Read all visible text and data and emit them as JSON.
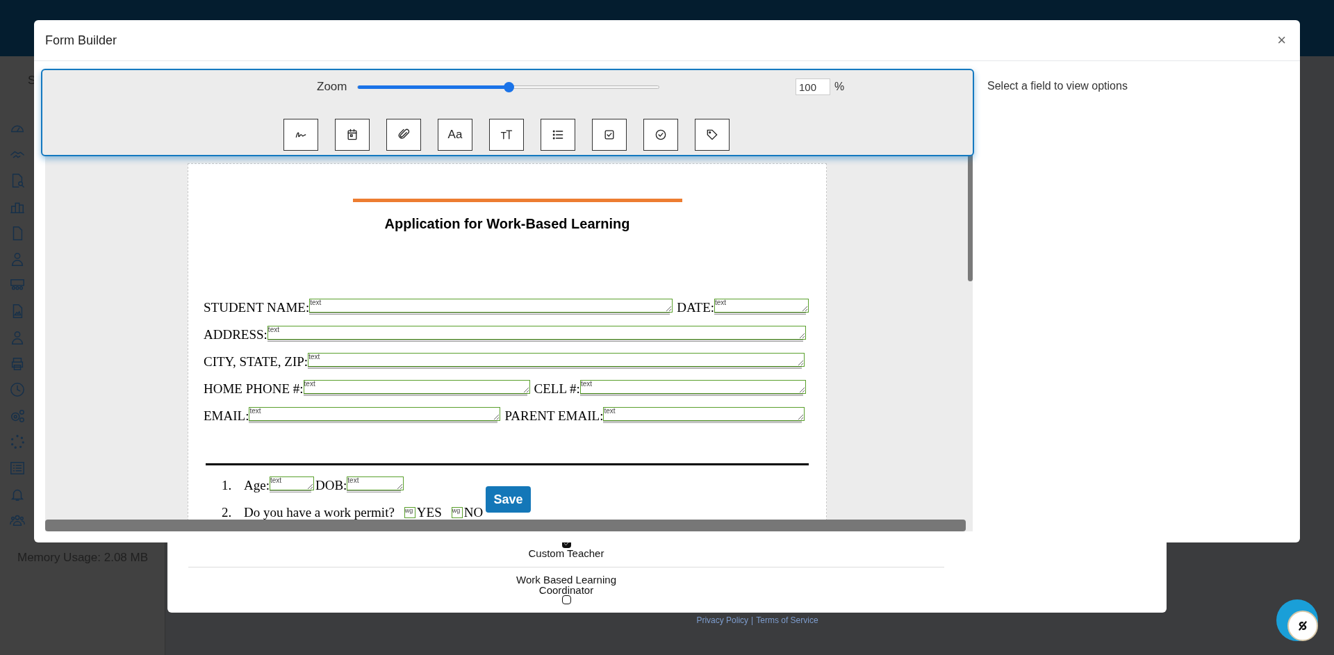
{
  "background": {
    "sidebar": {
      "heading": "S",
      "memory_usage": "Memory Usage: 2.08 MB"
    },
    "card": {
      "rows": [
        {
          "label": "Custom Teacher",
          "checked": true
        },
        {
          "label": "Work Based Learning Coordinator",
          "checked": false
        }
      ]
    },
    "footer": {
      "links": [
        "Privacy Policy",
        "Terms of Service"
      ],
      "separator": "|"
    }
  },
  "modal": {
    "title": "Form Builder",
    "close": "×",
    "toolbar": {
      "zoom_label": "Zoom",
      "zoom": {
        "level": 0.5
      },
      "zoom_value": "100",
      "zoom_unit": "%",
      "tools": [
        {
          "kind": "signature"
        },
        {
          "kind": "date"
        },
        {
          "kind": "attachment"
        },
        {
          "kind": "font",
          "glyph": "Aa"
        },
        {
          "kind": "text-size"
        },
        {
          "kind": "list"
        },
        {
          "kind": "checkbox"
        },
        {
          "kind": "check-circle"
        },
        {
          "kind": "tag"
        }
      ]
    },
    "options_hint": "Select a field to view options",
    "document": {
      "title": "Application  for Work-Based Learning",
      "rows": [
        {
          "items": [
            {
              "kind": "label",
              "text": "STUDENT NAME:"
            },
            {
              "kind": "field",
              "placeholder": "text"
            },
            {
              "kind": "label",
              "text": "DATE:"
            },
            {
              "kind": "field",
              "placeholder": "text"
            }
          ]
        },
        {
          "items": [
            {
              "kind": "label",
              "text": "ADDRESS:"
            },
            {
              "kind": "field",
              "placeholder": "text"
            }
          ]
        },
        {
          "items": [
            {
              "kind": "label",
              "text": "CITY, STATE, ZIP:"
            },
            {
              "kind": "field",
              "placeholder": "text"
            }
          ]
        },
        {
          "items": [
            {
              "kind": "label",
              "text": "HOME PHONE #:"
            },
            {
              "kind": "field",
              "placeholder": "text"
            },
            {
              "kind": "label",
              "text": "CELL #:"
            },
            {
              "kind": "field",
              "placeholder": "text"
            }
          ]
        },
        {
          "items": [
            {
              "kind": "label",
              "text": "EMAIL:"
            },
            {
              "kind": "field",
              "placeholder": "text"
            },
            {
              "kind": "label",
              "text": "PARENT EMAIL:"
            },
            {
              "kind": "field",
              "placeholder": "text"
            }
          ]
        }
      ],
      "questions": [
        {
          "number": "1.",
          "items": [
            {
              "kind": "label",
              "text": "Age:"
            },
            {
              "kind": "field",
              "placeholder": "text"
            },
            {
              "kind": "label",
              "text": "DOB:"
            },
            {
              "kind": "field",
              "placeholder": "text"
            }
          ]
        },
        {
          "number": "2.",
          "items": [
            {
              "kind": "label",
              "text": "Do you have a work permit?"
            },
            {
              "kind": "box",
              "placeholder": "wg"
            },
            {
              "kind": "label",
              "text": "YES"
            },
            {
              "kind": "box",
              "placeholder": "wg"
            },
            {
              "kind": "label",
              "text": "NO"
            }
          ]
        }
      ]
    },
    "save_button": "Save"
  }
}
